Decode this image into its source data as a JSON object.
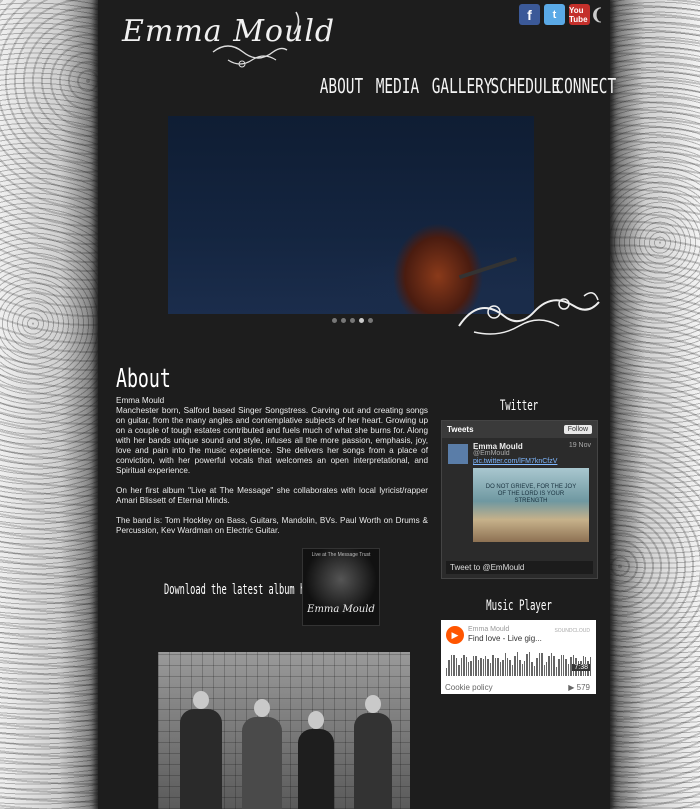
{
  "site": {
    "logo_text": "Emma Mould",
    "social": [
      {
        "name": "facebook",
        "glyph": "f"
      },
      {
        "name": "twitter",
        "glyph": "t"
      },
      {
        "name": "youtube",
        "glyph": "You Tube"
      }
    ]
  },
  "nav": [
    "ABOUT",
    "MEDIA",
    "GALLERY",
    "SCHEDULE",
    "CONNECT"
  ],
  "about": {
    "heading": "About",
    "name_line": "Emma Mould",
    "p1": "Manchester born, Salford based Singer Songstress. Carving out and creating songs on guitar, from the many angles and contemplative subjects of her heart. Growing up on a couple of tough estates contributed and fuels much of what she burns for. Along with her bands unique sound and style, infuses all the more passion, emphasis, joy, love and pain into the music experience. She delivers her songs from a place of conviction, with her powerful vocals that welcomes an open interpretational, and Spiritual experience.",
    "p2": "On her first album \"Live at The Message\" she collaborates with local lyricist/rapper Amari Blissett of Eternal Minds.",
    "p3": "The band is: Tom Hockley on Bass, Guitars, Mandolin, BVs. Paul Worth on Drums & Percussion, Kev Wardman on Electric Guitar."
  },
  "download": {
    "label": "Download the latest album here",
    "album_top": "Live at The Message Trust",
    "album_name": "Emma Mould"
  },
  "twitter": {
    "heading": "Twitter",
    "tweets_label": "Tweets",
    "follow_label": "Follow",
    "name": "Emma Mould",
    "handle": "@EmMould",
    "date": "19 Nov",
    "link": "pic.twitter.com/lFM7knCfzV",
    "image_quote": "DO NOT GRIEVE, FOR THE JOY OF THE LORD IS YOUR STRENGTH",
    "footer": "Tweet to @EmMould"
  },
  "music_player": {
    "heading": "Music Player",
    "artist": "Emma Mould",
    "track": "Find love - Live gig...",
    "logo": "SOUNDCLOUD",
    "time": "7:38",
    "cookie": "Cookie policy",
    "plays": "▶ 579"
  },
  "slider": {
    "dots": 5,
    "active": 3
  }
}
